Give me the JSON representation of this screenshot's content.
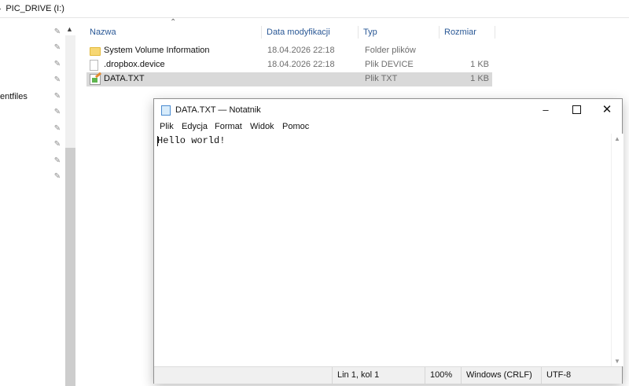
{
  "explorer": {
    "address_path": "PIC_DRIVE (I:)",
    "nav_partial_label": "entfiles",
    "columns": [
      "Nazwa",
      "Data modyfikacji",
      "Typ",
      "Rozmiar"
    ],
    "rows": [
      {
        "name": "System Volume Information",
        "date": "18.04.2026 22:18",
        "type": "Folder plików",
        "size": "",
        "icon": "folder-icon"
      },
      {
        "name": ".dropbox.device",
        "date": "18.04.2026 22:18",
        "type": "Plik DEVICE",
        "size": "1 KB",
        "icon": "file-icon"
      },
      {
        "name": "DATA.TXT",
        "date": "",
        "type": "Plik TXT",
        "size": "1 KB",
        "icon": "text-file-icon",
        "selected": true
      }
    ]
  },
  "notepad": {
    "title": "DATA.TXT — Notatnik",
    "menu": [
      "Plik",
      "Edycja",
      "Format",
      "Widok",
      "Pomoc"
    ],
    "content": "Hello world!",
    "status": {
      "position": "Lin 1, kol 1",
      "zoom": "100%",
      "line_endings": "Windows (CRLF)",
      "encoding": "UTF-8"
    }
  }
}
